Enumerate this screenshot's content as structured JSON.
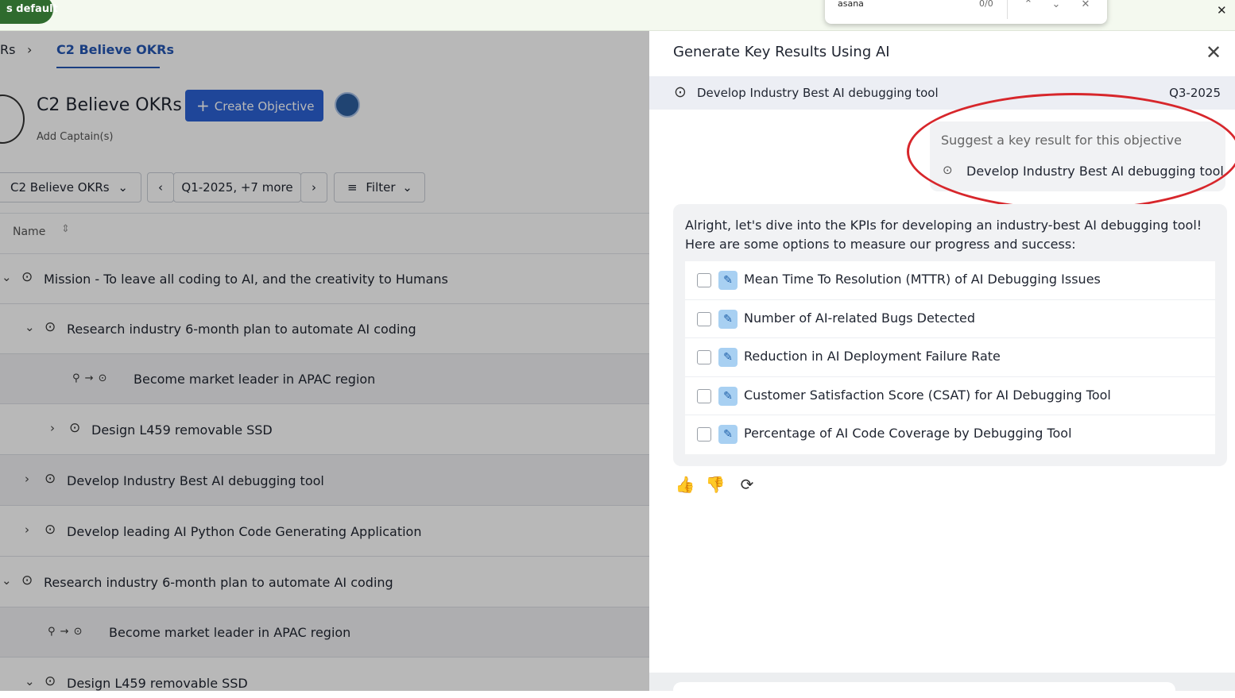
{
  "browser": {
    "default_badge": "s default",
    "find": {
      "query": "asana",
      "count": "0/0",
      "prev": "⌃",
      "next": "⌄",
      "close": "✕"
    },
    "close": "✕"
  },
  "okr_page": {
    "breadcrumb": {
      "parent": "Rs",
      "separator": "›",
      "current": "C2 Believe OKRs"
    },
    "title": "C2 Believe OKRs",
    "create_button": "Create Objective",
    "create_plus": "+",
    "add_captains": "Add Captain(s)",
    "filters": {
      "team": "C2 Believe OKRs",
      "team_chevron": "⌄",
      "prev": "‹",
      "period": "Q1-2025, +7 more",
      "next": "›",
      "filter_icon": "≡",
      "filter": "Filter",
      "filter_chevron": "⌄"
    },
    "column": {
      "name": "Name",
      "sort_icon": "⇕"
    },
    "rows": [
      {
        "chevron": "⌄",
        "target": "⊙",
        "text": "Mission - To leave all coding to AI, and the creativity to Humans"
      },
      {
        "chevron": "⌄",
        "target": "⊙",
        "text": "Research industry 6-month plan to automate AI coding"
      },
      {
        "link": "⚲ → ⊙",
        "text": "Become market leader in APAC region"
      },
      {
        "chevron": "›",
        "target": "⊙",
        "text": "Design L459 removable SSD"
      },
      {
        "chevron": "›",
        "target": "⊙",
        "text": "Develop Industry Best AI debugging tool"
      },
      {
        "chevron": "›",
        "target": "⊙",
        "text": "Develop leading AI Python Code Generating Application"
      },
      {
        "chevron": "⌄",
        "target": "⊙",
        "text": "Research industry 6-month plan to automate AI coding"
      },
      {
        "link": "⚲ → ⊙",
        "text": "Become market leader in APAC region"
      },
      {
        "chevron": "⌄",
        "target": "⊙",
        "text": "Design L459 removable SSD"
      }
    ]
  },
  "drawer": {
    "title": "Generate Key Results Using AI",
    "close": "✕",
    "objective": {
      "target": "⊙",
      "name": "Develop Industry Best AI debugging tool",
      "quarter": "Q3-2025"
    },
    "suggestion": {
      "hint": "Suggest a key result for this objective",
      "target": "⊙",
      "objective": "Develop Industry Best AI debugging tool"
    },
    "response": {
      "intro": "Alright, let's dive into the KPIs for developing an industry-best AI debugging tool! Here are some options to measure our progress and success:",
      "edit_icon": "✎",
      "key_results": [
        "Mean Time To Resolution (MTTR) of AI Debugging Issues",
        "Number of AI-related Bugs Detected",
        "Reduction in AI Deployment Failure Rate",
        "Customer Satisfaction Score (CSAT) for AI Debugging Tool",
        "Percentage of AI Code Coverage by Debugging Tool"
      ]
    },
    "feedback": {
      "like": "👍",
      "dislike": "👎",
      "regenerate": "⟳"
    }
  }
}
